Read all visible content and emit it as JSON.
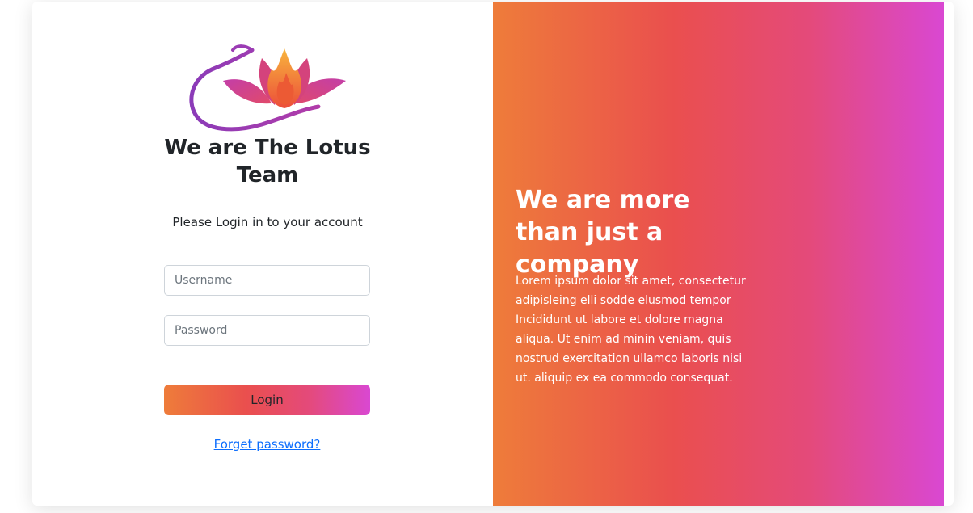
{
  "left_panel": {
    "logo_icon": "lotus-logo",
    "team_title": "We are The Lotus Team",
    "subtitle": "Please Login in to your account",
    "username_placeholder": "Username",
    "password_placeholder": "Password",
    "login_label": "Login",
    "forgot_label": "Forget password?"
  },
  "right_panel": {
    "heading": "We are more than just a company",
    "body": "Lorem ipsum dolor sit amet, consectetur adipisleing elli sodde elusmod tempor Incididunt ut labore et dolore magna aliqua. Ut enim ad minin veniam, quis nostrud exercitation ullamco laboris nisi ut. aliquip ex ea commodo consequat."
  },
  "colors": {
    "gradient_start": "#ee7c3a",
    "gradient_mid": "#ea4f4e",
    "gradient_end": "#d948d2",
    "link": "#0d6efd",
    "title_text": "#212529"
  }
}
